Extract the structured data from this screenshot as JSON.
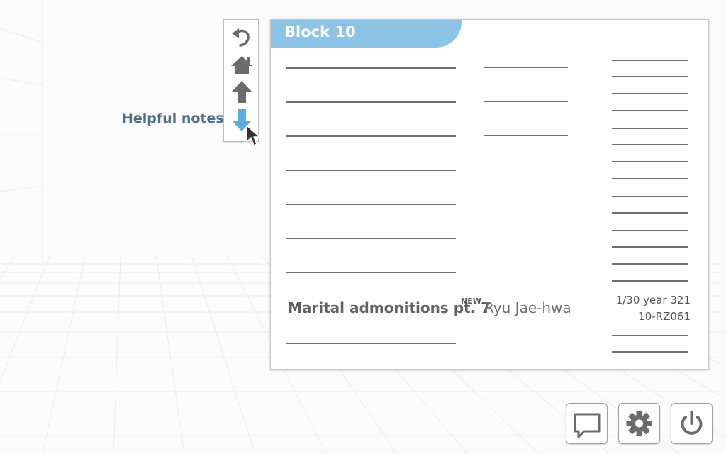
{
  "sidebar": {
    "notes_label": "Helpful notes"
  },
  "nav": {
    "buttons": [
      {
        "icon": "undo-arrow-icon",
        "active": false
      },
      {
        "icon": "home-icon",
        "active": false
      },
      {
        "icon": "arrow-up-icon",
        "active": false
      },
      {
        "icon": "arrow-down-icon",
        "active": true
      }
    ]
  },
  "card": {
    "title": "Block 10",
    "entry": {
      "title": "Marital admonitions pt. 7",
      "badge": "NEW",
      "author": "Ryu Jae-hwa",
      "date": "1/30 year 321",
      "code": "10-RZ061"
    }
  },
  "footer": {
    "buttons": [
      {
        "icon": "chat-bubble-icon"
      },
      {
        "icon": "gear-icon"
      },
      {
        "icon": "power-icon"
      }
    ]
  },
  "colors": {
    "accent": "#8cc4e6",
    "active_icon": "#5aaee0",
    "icon": "#6b6b6b",
    "label": "#4d6f88"
  }
}
